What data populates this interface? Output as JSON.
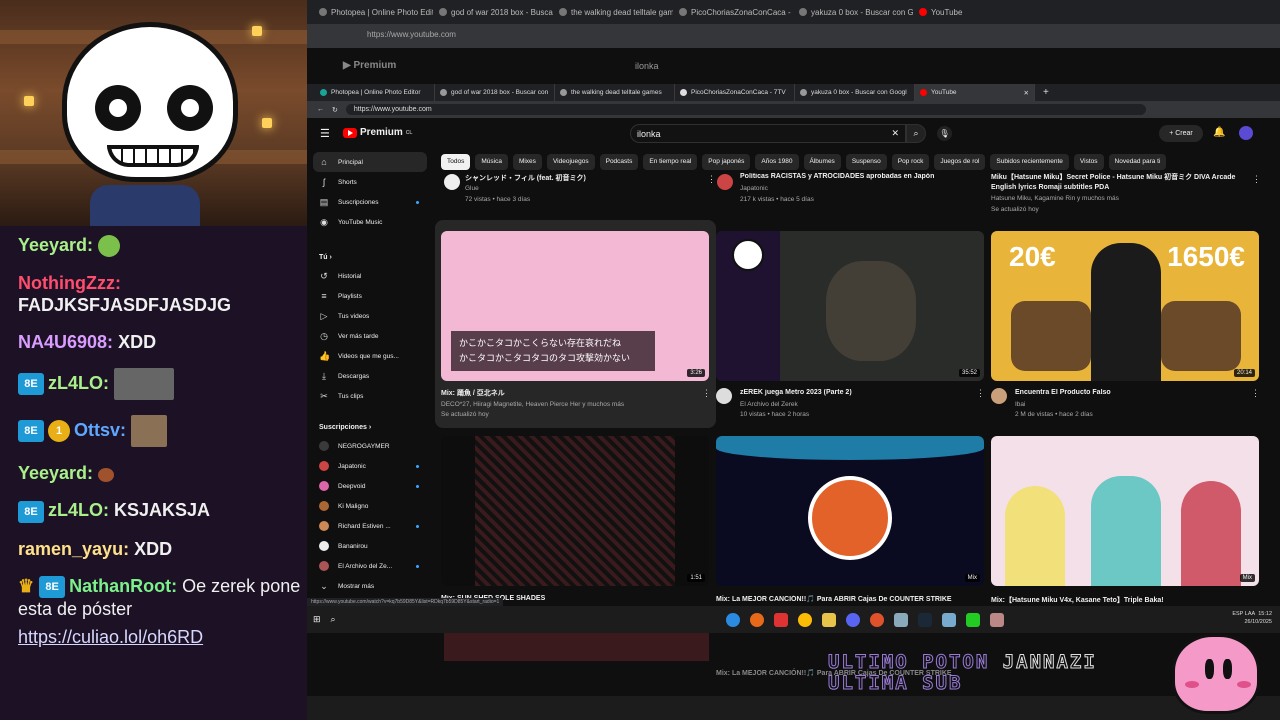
{
  "chat": {
    "messages": [
      {
        "user": "Yeeyard:",
        "user_color": "#a9f08a",
        "text": "",
        "emote": "circle"
      },
      {
        "user": "NothingZzz:",
        "user_color": "#ff4d6d",
        "text": "FADJKSFJASDFJASDJG"
      },
      {
        "user": "NA4U6908:",
        "user_color": "#d99cff",
        "text": "XDD"
      },
      {
        "user": "zL4LO:",
        "user_color": "#a9f08a",
        "text": "",
        "emote": "photo",
        "badge": "8E"
      },
      {
        "user": "Ottsv:",
        "user_color": "#5fa8ff",
        "text": "",
        "emote": "cat",
        "badge": "8E",
        "badge2": "1"
      },
      {
        "user": "Yeeyard:",
        "user_color": "#a9f08a",
        "text": "",
        "emote": "small"
      },
      {
        "user": "zL4LO:",
        "user_color": "#a9f08a",
        "text": "KSJAKSJA",
        "badge": "8E"
      },
      {
        "user": "ramen_yayu:",
        "user_color": "#ffe08a",
        "text": "XDD"
      },
      {
        "user": "NathanRoot:",
        "user_color": "#7cf08a",
        "text": "Oe zerek pone esta de póster",
        "badge": "8E",
        "crown": true
      }
    ],
    "link": "https://culiao.lol/oh6RD"
  },
  "outer_browser": {
    "tabs": [
      "Photopea | Online Photo Editor",
      "god of war 2018 box - Buscar con",
      "the walking dead telltale games",
      "PicoChoriasZonaConCaca - 7TV",
      "yakuza 0 box - Buscar con Googl",
      "YouTube"
    ],
    "url": "https://www.youtube.com",
    "search": "ilonka"
  },
  "browser": {
    "tabs": [
      "Photopea | Online Photo Editor",
      "god of war 2018 box - Buscar con",
      "the walking dead telltale games",
      "PicoChoriasZonaConCaca - 7TV",
      "yakuza 0 box - Buscar con Googl",
      "YouTube"
    ],
    "url": "https://www.youtube.com"
  },
  "youtube": {
    "logo": "Premium",
    "logo_sup": "CL",
    "search_value": "ilonka",
    "create_label": "+ Crear",
    "sidebar": {
      "main": [
        "Principal",
        "Shorts",
        "Suscripciones",
        "YouTube Music"
      ],
      "you_header": "Tú",
      "you": [
        "Historial",
        "Playlists",
        "Tus videos",
        "Ver más tarde",
        "Videos que me gus...",
        "Descargas",
        "Tus clips"
      ],
      "subs_header": "Suscripciones",
      "subs": [
        "NEGROGAYMER",
        "Japatonic",
        "Deepvoid",
        "Ki Maligno",
        "Richard Estiven ...",
        "Bananirou",
        "El Archivo del Ze..."
      ],
      "more": "Mostrar más"
    },
    "chips": [
      "Todos",
      "Música",
      "Mixes",
      "Videojuegos",
      "Podcasts",
      "En tiempo real",
      "Pop japonés",
      "Años 1980",
      "Álbumes",
      "Suspenso",
      "Pop rock",
      "Juegos de rol",
      "Subidos recientemente",
      "Vistos",
      "Novedad para ti"
    ],
    "top_row": [
      {
        "title": "シャンレッド・フィル (feat. 初音ミク)",
        "meta1": "Glue",
        "meta2": "72 vistas • hace 3 días"
      },
      {
        "title": "Políticas RACISTAS y ATROCIDADES aprobadas en Japón",
        "meta1": "Japatonic",
        "meta2": "217 k vistas • hace 5 días"
      },
      {
        "title": "Miku【Hatsune Miku】Secret Police - Hatsune Miku 初音ミク DIVA Arcade English lyrics Romaji subtitles PDA",
        "meta1": "Hatsune Miku, Kagamine Rin y muchos más",
        "meta2": "Se actualizó hoy"
      }
    ],
    "videos": [
      {
        "title": "Mix: 踊魚 / 亞北ネル",
        "meta1": "DECO*27, Hiiragi Magnetite, Heaven Pierce Her y muchos más",
        "meta2": "Se actualizó hoy",
        "duration": "3:26",
        "lyric1": "かこかこタコかこくらない存在哀れだね",
        "lyric2": "かこタコかこタコタコのタコ攻撃効かない",
        "thumb_color": "#f3b8d4"
      },
      {
        "title": "zEREK juega Metro 2023 (Parte 2)",
        "meta1": "El Archivo del Zerek",
        "meta2": "10 vistas • hace 2 horas",
        "duration": "35:52",
        "thumb_color": "#2a2c2a"
      },
      {
        "title": "Encuentra El Producto Falso",
        "meta1": "Ibai",
        "meta2": "2 M de vistas • hace 2 días",
        "duration": "20:14",
        "price1": "20€",
        "price2": "1650€",
        "thumb_color": "#e9b43a"
      },
      {
        "title": "Mix: SUN SHED SOLE SHADES",
        "duration": "1:51",
        "thumb_color": "#3a1a1c"
      },
      {
        "title": "Mix: La MEJOR CANCIÓN!!🎵 Para ABRIR Cajas De COUNTER STRIKE",
        "badge": "Mix",
        "thumb_color": "#0a0a20"
      },
      {
        "title": "Mix:【Hatsune Miku V4x, Kasane Teto】Triple Baka!",
        "badge": "Mix",
        "thumb_color": "#f4e0e8"
      }
    ],
    "status_url": "https://www.youtube.com/watch?v=kq7b59D85Y&list=RDkq7b59D85Y&start_radio=1"
  },
  "taskbar": {
    "lang": "ESP LAA",
    "time": "15:12",
    "date": "26/10/2025"
  },
  "overlay": {
    "line1": "ULTIMO POTON",
    "line2": "ULTIMA SUB",
    "name": "JANNAZI"
  }
}
